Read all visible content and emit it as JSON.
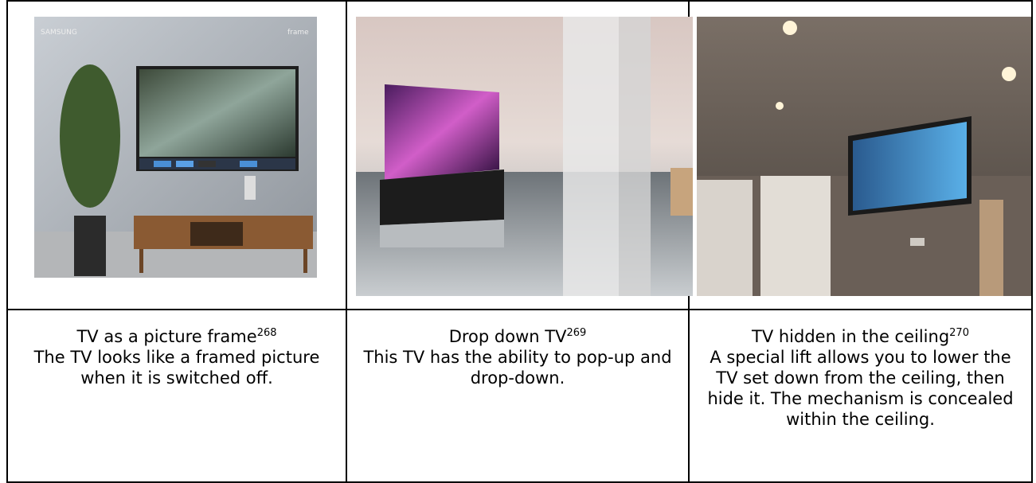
{
  "cells": [
    {
      "title": "TV as a picture frame",
      "ref": "268",
      "desc": "The TV looks like a framed picture when it is switched off.",
      "image": {
        "brand_text": "SAMSUNG",
        "logo_text": "frame"
      }
    },
    {
      "title": "Drop down TV",
      "ref": "269",
      "desc": "This TV has the ability to pop-up and drop-down."
    },
    {
      "title": "TV hidden in the ceiling",
      "ref": "270",
      "desc": "A special lift allows you to lower the TV set down from the ceiling, then hide it. The mechanism is concealed within the ceiling."
    }
  ]
}
